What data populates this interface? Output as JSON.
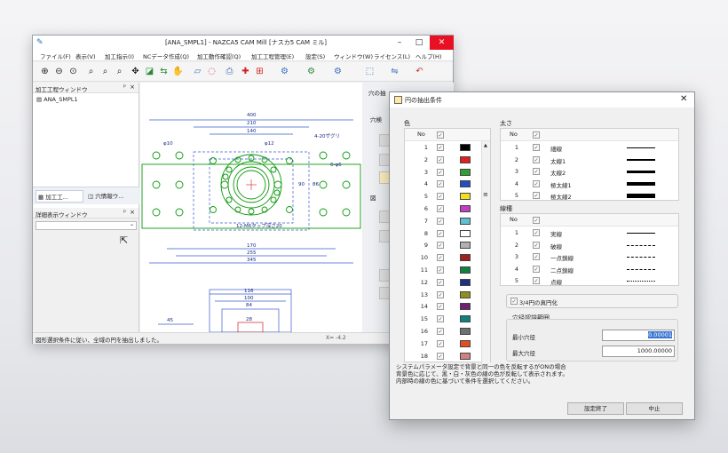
{
  "window": {
    "title": "[ANA_SMPL1] - NAZCA5 CAM Mill [ナスカ5 CAM ミル]",
    "controls": {
      "minimize": "–",
      "maximize": "□",
      "close": "✕"
    }
  },
  "menu": [
    "ファイル(F)",
    "表示(V)",
    "加工指示(I)",
    "NCデータ作成(Q)",
    "加工動作確認(Q)",
    "加工工程管理(E)",
    "設定(S)",
    "ウィンドウ(W)",
    "ライセンス(L)",
    "ヘルプ(H)"
  ],
  "process_pane": {
    "title": "加工工程ウィンドウ",
    "pin": "ᵖ",
    "close": "×",
    "item": "ANA_SMPL1",
    "tabs": [
      "加工工...",
      "穴情報ウ..."
    ]
  },
  "detail_pane": {
    "title": "詳細表示ウィンドウ",
    "pin": "ᵖ",
    "close": "×"
  },
  "side_panel": {
    "title": "穴の抽",
    "label2": "穴検",
    "label3": "図"
  },
  "drawing": {
    "dims_top": [
      "400",
      "210",
      "140"
    ],
    "dims_bottom": [
      "170",
      "255",
      "345"
    ],
    "labels": [
      "φ10",
      "φ12",
      "4-20ザグリ",
      "12-M6タップ深さ20",
      "6-φ6",
      "90",
      "86"
    ],
    "lower_dims": [
      "116",
      "100",
      "84",
      "28",
      "45"
    ]
  },
  "status": {
    "text": "図形選択条件に従い、全域の円を抽出しました。",
    "coords": "X= -4.2"
  },
  "dialog": {
    "title": "円の抽出条件",
    "close": "✕",
    "color_group": {
      "label": "色",
      "header_no": "No",
      "rows": [
        {
          "no": "1",
          "color": "#000000"
        },
        {
          "no": "2",
          "color": "#e02020"
        },
        {
          "no": "3",
          "color": "#30a030"
        },
        {
          "no": "4",
          "color": "#2050c0"
        },
        {
          "no": "5",
          "color": "#f0e020"
        },
        {
          "no": "6",
          "color": "#c040c0"
        },
        {
          "no": "7",
          "color": "#60c0d0"
        },
        {
          "no": "8",
          "color": "#ffffff"
        },
        {
          "no": "9",
          "color": "#b0b0b0"
        },
        {
          "no": "10",
          "color": "#a02020"
        },
        {
          "no": "11",
          "color": "#108040"
        },
        {
          "no": "12",
          "color": "#203080"
        },
        {
          "no": "13",
          "color": "#909020"
        },
        {
          "no": "14",
          "color": "#702070"
        },
        {
          "no": "15",
          "color": "#108080"
        },
        {
          "no": "16",
          "color": "#707070"
        },
        {
          "no": "17",
          "color": "#e05020"
        },
        {
          "no": "18",
          "color": "#d08080"
        }
      ]
    },
    "thickness_group": {
      "label": "太さ",
      "header_no": "No",
      "rows": [
        {
          "no": "1",
          "label": "細線",
          "w": 1
        },
        {
          "no": "2",
          "label": "太線1",
          "w": 2
        },
        {
          "no": "3",
          "label": "太線2",
          "w": 3
        },
        {
          "no": "4",
          "label": "極太線1",
          "w": 4
        },
        {
          "no": "5",
          "label": "極太線2",
          "w": 5
        }
      ]
    },
    "linetype_group": {
      "label": "線種",
      "header_no": "No",
      "rows": [
        {
          "no": "1",
          "label": "実線",
          "style": "solid"
        },
        {
          "no": "2",
          "label": "破線",
          "style": "dashed"
        },
        {
          "no": "3",
          "label": "一点鎖線",
          "style": "dashed"
        },
        {
          "no": "4",
          "label": "二点鎖線",
          "style": "dashed"
        },
        {
          "no": "5",
          "label": "点線",
          "style": "dotted"
        }
      ]
    },
    "quarter_circle": {
      "label": "3/4円の真円化",
      "checked": true
    },
    "hole_range": {
      "label": "穴径認識範囲",
      "min_label": "最小穴径",
      "min_value": "0.00001",
      "max_label": "最大穴径",
      "max_value": "1000.00000"
    },
    "note": "システムパラメータ設定で背景と同一の色を反転するがONの場合\n背景色に応じて、黒・白・灰色の線の色が反転して表示されます。\n内部時の線の色に基づいて条件を選択してください。",
    "buttons": {
      "ok": "設定終了",
      "cancel": "中止"
    }
  }
}
